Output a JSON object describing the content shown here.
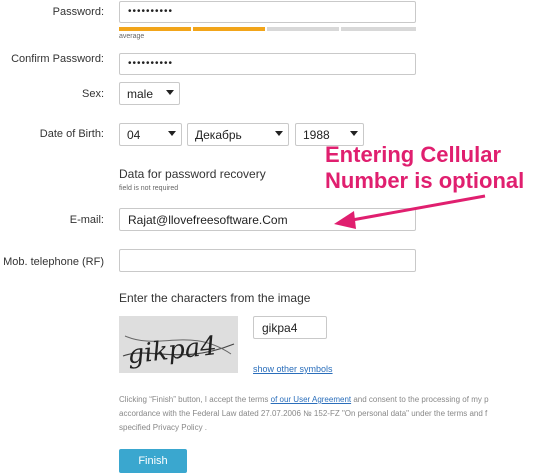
{
  "form": {
    "password": {
      "label": "Password:",
      "value": "••••••••••"
    },
    "strength": {
      "text": "average",
      "level": 0.5,
      "colors": {
        "filled": "#f2a51a",
        "empty": "#d8d8d8"
      }
    },
    "confirm_password": {
      "label": "Confirm Password:",
      "value": "••••••••••"
    },
    "sex": {
      "label": "Sex:",
      "value": "male"
    },
    "dob": {
      "label": "Date of Birth:",
      "day": "04",
      "month": "Декабрь",
      "year": "1988"
    },
    "recovery": {
      "title": "Data for password recovery",
      "note": "field is not required"
    },
    "email": {
      "label": "E-mail:",
      "value": "Rajat@llovefreesoftware.Com"
    },
    "mobile": {
      "label": "Mob. telephone (RF)",
      "value": ""
    },
    "captcha": {
      "title": "Enter the characters from the image",
      "image_text": "gikpa4",
      "value": "gikpa4",
      "other_link": "show other symbols"
    },
    "legal": {
      "line1_before": "Clicking “Finish” button, I accept the terms ",
      "line1_link": "of our User Agreement",
      "line1_after": " and consent to the processing of my p",
      "line2": "accordance with the Federal Law dated 27.07.2006 № 152-FZ \"On personal data\" under the terms and f",
      "line3": "specified Privacy Policy ."
    },
    "finish_label": "Finish"
  },
  "annotation": {
    "line1": "Entering Cellular",
    "line2": "Number is optional",
    "color": "#e01f6f"
  }
}
